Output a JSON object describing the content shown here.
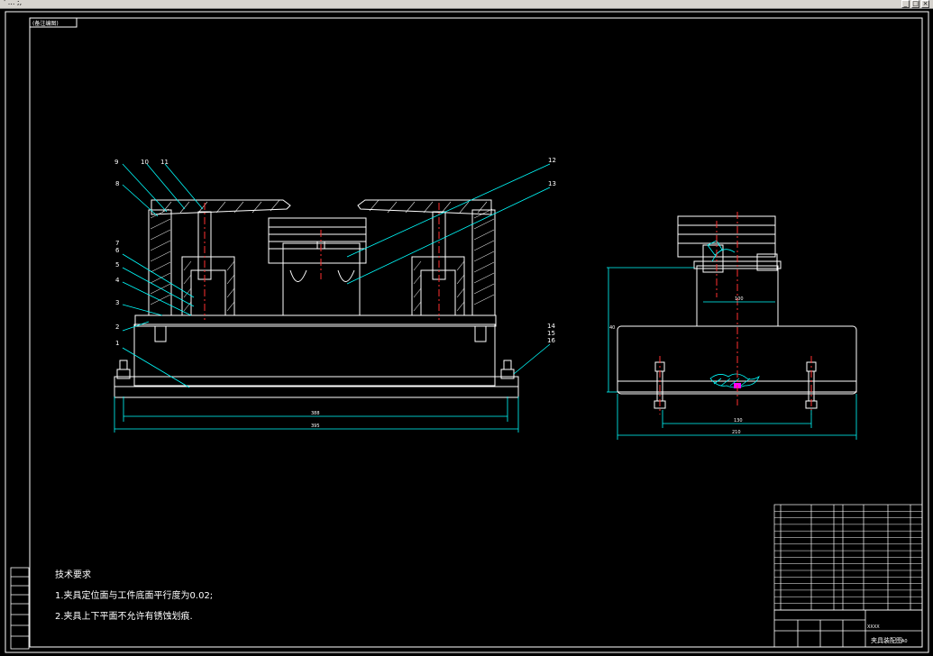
{
  "window": {
    "title": "' ... ;,",
    "controls": [
      "minimize",
      "maximize",
      "close"
    ]
  },
  "drawing": {
    "view_label": "(备注编图)",
    "balloons": [
      "1",
      "2",
      "3",
      "4",
      "5",
      "6",
      "7",
      "8",
      "9",
      "10",
      "11",
      "12",
      "13",
      "14",
      "15",
      "16"
    ],
    "dimensions": {
      "front_inner": "388",
      "front_overall": "395",
      "side_base_width": "210",
      "side_bolt_spacing": "130",
      "side_height": "40",
      "side_upper": "100"
    },
    "tech_requirements": {
      "heading": "技术要求",
      "items": [
        "1.夹具定位面与工件底面平行度为0.02;",
        "2.夹具上下平面不允许有锈蚀划痕."
      ]
    },
    "title_block": {
      "drawing_name": "夹具装配图",
      "scale_label": "A0",
      "code": "XXXX"
    },
    "colors": {
      "background": "#000000",
      "line": "#ffffff",
      "dimension": "#00ffff",
      "center": "#ff3030",
      "leader": "#00ffff",
      "accent": "#ff00ff"
    }
  }
}
